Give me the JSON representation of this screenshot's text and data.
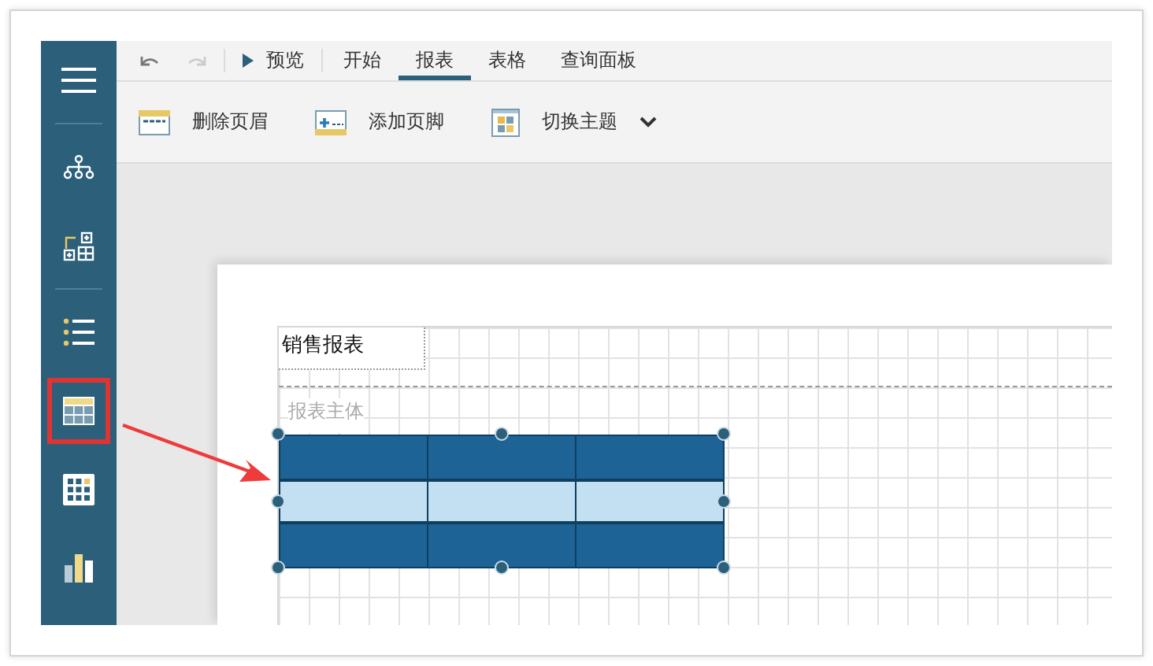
{
  "toolbar": {
    "undo": {
      "disabled": false
    },
    "redo": {
      "disabled": true
    },
    "preview": {
      "label": "预览"
    },
    "tabs": [
      {
        "label": "开始",
        "selected": false
      },
      {
        "label": "报表",
        "selected": true
      },
      {
        "label": "表格",
        "selected": false
      },
      {
        "label": "查询面板",
        "selected": false
      }
    ]
  },
  "ribbon": [
    {
      "kind": "remove-header",
      "label": "删除页眉"
    },
    {
      "kind": "add-footer",
      "label": "添加页脚"
    },
    {
      "kind": "theme",
      "label": "切换主题",
      "dropdown": true
    }
  ],
  "sidebar": {
    "groups": [
      [
        {
          "kind": "menu",
          "selected": false
        }
      ],
      [
        {
          "kind": "hierarchy",
          "selected": false
        },
        {
          "kind": "add-grid",
          "selected": false
        }
      ],
      [
        {
          "kind": "list",
          "selected": false
        },
        {
          "kind": "table",
          "selected": true
        },
        {
          "kind": "matrix",
          "selected": false
        },
        {
          "kind": "chart",
          "selected": false
        }
      ]
    ]
  },
  "report": {
    "header_text": "销售报表",
    "body_label": "报表主体",
    "table": {
      "selected": true,
      "rows": [
        {
          "kind": "header"
        },
        {
          "kind": "detail"
        },
        {
          "kind": "footer"
        }
      ]
    }
  },
  "annotation": {
    "kind": "arrow"
  }
}
